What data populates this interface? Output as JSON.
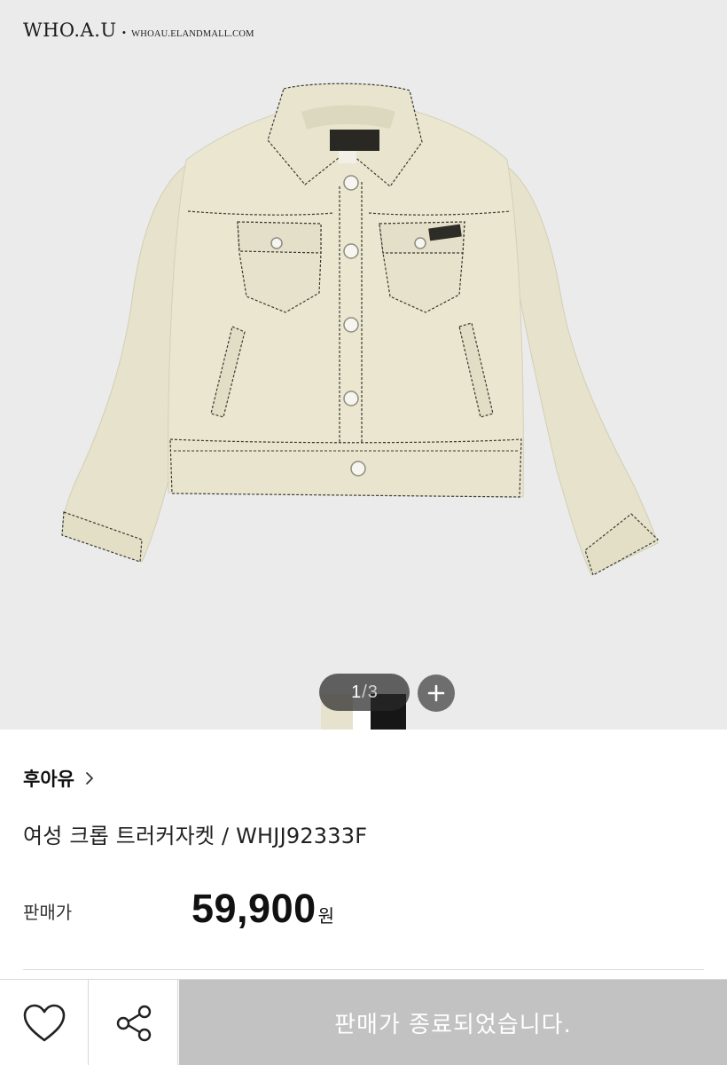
{
  "header": {
    "logo_main": "WHO.A.U",
    "logo_dot": "•",
    "logo_sub": "WHOAU.ELANDMALL.COM"
  },
  "gallery": {
    "current": "1",
    "separator": "/",
    "total": "3",
    "zoom_icon": "plus-icon",
    "swatch_colors": [
      "#e7e2cd",
      "#ffffff",
      "#161616"
    ]
  },
  "product": {
    "brand": "후아유",
    "brand_chevron": "chevron-right-icon",
    "title": "여성 크롭 트러커자켓 / WHJJ92333F",
    "price_label": "판매가",
    "price": "59,900",
    "price_unit": "원"
  },
  "actions": {
    "like_icon": "heart-icon",
    "share_icon": "share-icon",
    "status_text": "판매가 종료되었습니다."
  },
  "colors": {
    "image_bg": "#ebebeb",
    "jacket": "#e9e5cf",
    "stitch": "#3a3a32",
    "sold_out_bg": "#c2c2c2"
  }
}
